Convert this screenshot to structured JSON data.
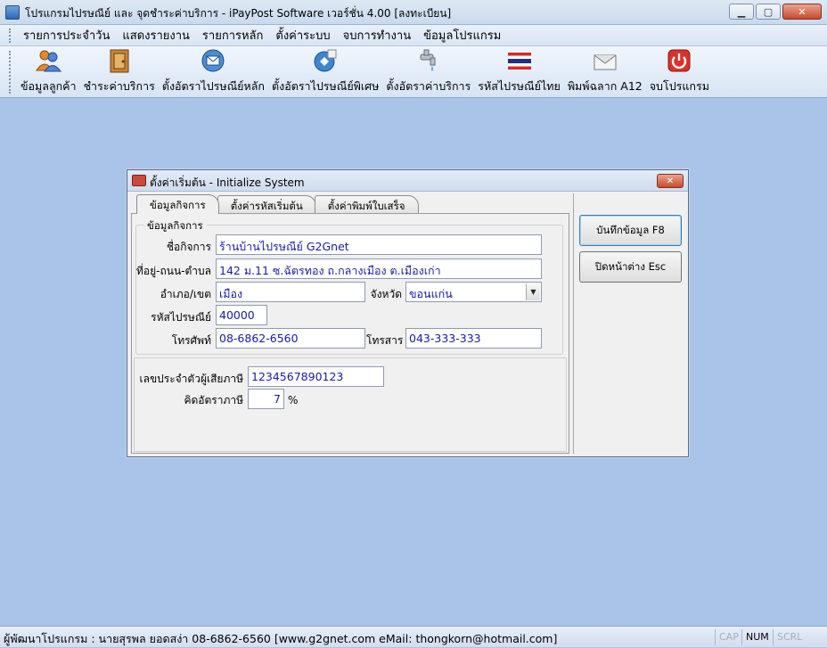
{
  "window": {
    "title": "โปรแกรมไปรษณีย์ และ จุดชำระค่าบริการ - iPayPost Software เวอร์ชั่น 4.00 [ลงทะเบียน]",
    "minimize": "▁",
    "maximize": "▢",
    "close": "✕"
  },
  "menu": [
    "รายการประจำวัน",
    "แสดงรายงาน",
    "รายการหลัก",
    "ตั้งค่าระบบ",
    "จบการทำงาน",
    "ข้อมูลโปรแกรม"
  ],
  "toolbar": [
    {
      "label": "ข้อมูลลูกค้า",
      "icon": "users-icon"
    },
    {
      "label": "ชำระค่าบริการ",
      "icon": "door-icon"
    },
    {
      "label": "ตั้งอัตราไปรษณีย์หลัก",
      "icon": "mail-icon"
    },
    {
      "label": "ตั้งอัตราไปรษณีย์พิเศษ",
      "icon": "special-mail-icon"
    },
    {
      "label": "ตั้งอัตราค่าบริการ",
      "icon": "faucet-icon"
    },
    {
      "label": "รหัสไปรษณีย์ไทย",
      "icon": "thai-flag-icon"
    },
    {
      "label": "พิมพ์ฉลาก A12",
      "icon": "envelope-icon"
    },
    {
      "label": "จบโปรแกรม",
      "icon": "power-icon"
    }
  ],
  "dialog": {
    "title": "ตั้งค่าเริ่มต้น - Initialize System",
    "close": "✕",
    "tabs": [
      "ข้อมูลกิจการ",
      "ตั้งค่ารหัสเริ่มต้น",
      "ตั้งค่าพิมพ์ใบเสร็จ"
    ],
    "group_title": "ข้อมูลกิจการ",
    "fields": {
      "business_name_label": "ชื่อกิจการ",
      "business_name": "ร้านบ้านไปรษณีย์ G2Gnet",
      "address_label": "ที่อยู่-ถนน-ตำบล",
      "address": "142 ม.11 ซ.ฉัตรทอง ถ.กลางเมือง ต.เมืองเก่า",
      "district_label": "อำเภอ/เขต",
      "district": "เมือง",
      "province_label": "จังหวัด",
      "province": "ขอนแก่น",
      "postcode_label": "รหัสไปรษณีย์",
      "postcode": "40000",
      "phone_label": "โทรศัพท์",
      "phone": "08-6862-6560",
      "fax_label": "โทรสาร",
      "fax": "043-333-333",
      "taxid_label": "เลขประจำตัวผู้เสียภาษี",
      "taxid": "1234567890123",
      "taxrate_label": "คิดอัตราภาษี",
      "taxrate": "7",
      "taxrate_unit": "%"
    },
    "save_button": "บันทึกข้อมูล F8",
    "close_button": "ปิดหน้าต่าง Esc"
  },
  "status": {
    "text": "ผู้พัฒนาโปรแกรม : นายสุรพล ยอดสง่า 08-6862-6560  [www.g2gnet.com  eMail: thongkorn@hotmail.com]",
    "cap": "CAP",
    "num": "NUM",
    "scrl": "SCRL"
  }
}
